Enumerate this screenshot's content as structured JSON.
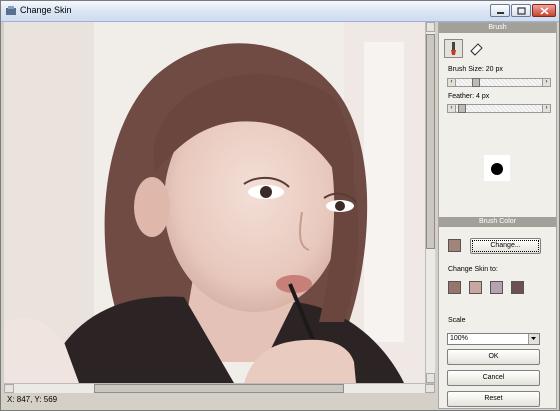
{
  "window": {
    "title": "Change Skin"
  },
  "status": {
    "coordinates": "X: 847, Y: 569"
  },
  "brush": {
    "header": "Brush",
    "size_label": "Brush Size: 20 px",
    "feather_label": "Feather: 4 px",
    "size_value": 20,
    "feather_value": 4
  },
  "brush_color": {
    "header": "Brush Color",
    "current_color": "#a2847b",
    "change_label": "Change...",
    "change_skin_label": "Change Skin to:",
    "skin_swatches": [
      "#98756c",
      "#c8a6a1",
      "#b7a1b4",
      "#6d5050"
    ]
  },
  "scale": {
    "label": "Scale",
    "value": "100%"
  },
  "buttons": {
    "ok": "OK",
    "cancel": "Cancel",
    "reset": "Reset"
  }
}
